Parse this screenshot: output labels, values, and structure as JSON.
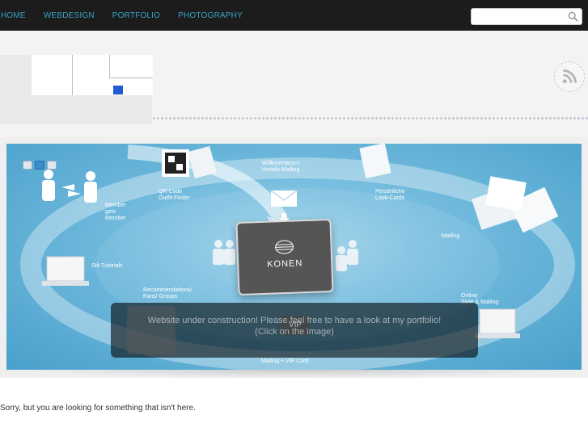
{
  "nav": {
    "items": [
      {
        "label": "HOME"
      },
      {
        "label": "WEBDESIGN"
      },
      {
        "label": "PORTFOLIO"
      },
      {
        "label": "PHOTOGRAPHY"
      }
    ]
  },
  "search": {
    "placeholder": "",
    "icon": "search-icon"
  },
  "banner": {
    "captions": {
      "qr": "QR Code\nOutfit-Finder",
      "welcome": "Willkommens-/\nVorteils-Mailing",
      "personal": "Persönliche\nLook-Cards",
      "member": "Member\ngets\nMember",
      "mailing": "Mailing",
      "tutorials": "Stil-Tutorials",
      "recommendations": "Recommendations/\nFans/ Groups",
      "online": "Online\nStyle & Mailing",
      "vip": "Mailing + VIP Card"
    },
    "brand": "KONEN",
    "card_label": "VIP",
    "overlay_text": "Website under construction! Please feel free to have a look at my portfolio!\n(Click on the image)"
  },
  "content": {
    "message": "Sorry, but you are looking for something that isn't here."
  },
  "colors": {
    "nav_bg": "#1c1c1c",
    "nav_link": "#36a3c4",
    "logo_accent": "#1f5bd1",
    "banner_blue": "#6fb9dc"
  }
}
